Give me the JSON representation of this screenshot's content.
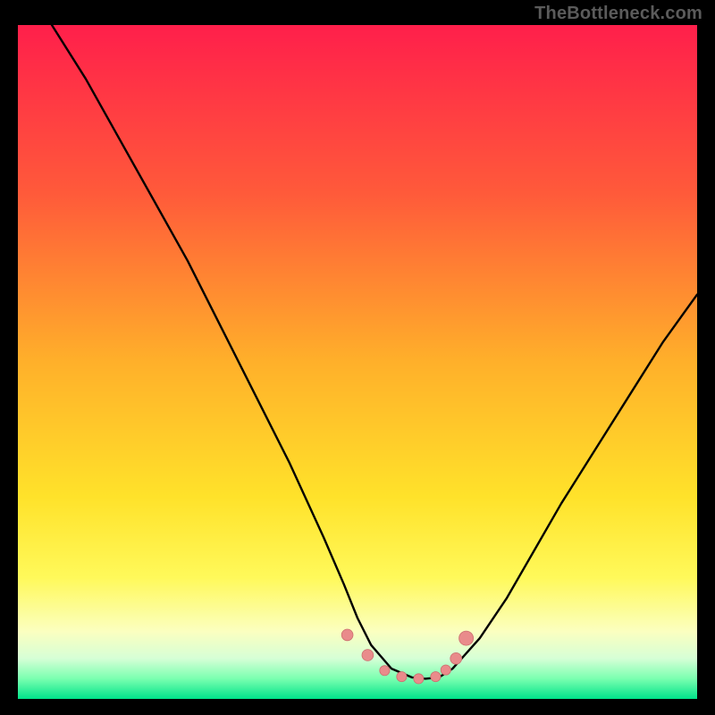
{
  "watermark": "TheBottleneck.com",
  "colors": {
    "frame": "#000000",
    "watermark": "#5b5b5b",
    "gradient_stops": [
      {
        "offset": 0.0,
        "color": "#ff1f4b"
      },
      {
        "offset": 0.25,
        "color": "#ff5a3a"
      },
      {
        "offset": 0.5,
        "color": "#ffb02a"
      },
      {
        "offset": 0.7,
        "color": "#ffe22a"
      },
      {
        "offset": 0.82,
        "color": "#fff95a"
      },
      {
        "offset": 0.9,
        "color": "#fbffc0"
      },
      {
        "offset": 0.94,
        "color": "#d6ffd6"
      },
      {
        "offset": 0.97,
        "color": "#7affb0"
      },
      {
        "offset": 1.0,
        "color": "#00e38a"
      }
    ],
    "curve_stroke": "#000000",
    "marker_fill": "#e98b8b",
    "marker_stroke": "#cc6f6f"
  },
  "chart_data": {
    "type": "line",
    "title": "",
    "xlabel": "",
    "ylabel": "",
    "xlim": [
      0,
      100
    ],
    "ylim": [
      0,
      100
    ],
    "grid": false,
    "legend": false,
    "description": "Bottleneck-style V-curve on vertical red→green gradient; minimum plateau near x≈55–63 at y≈3. Left branch descends steeply from top-left; right branch rises more gently to y≈60 at x=100. A small cluster of salmon markers sits around the trough.",
    "series": [
      {
        "name": "curve",
        "x": [
          5,
          10,
          15,
          20,
          25,
          30,
          35,
          40,
          45,
          48,
          50,
          52,
          55,
          58,
          60,
          62,
          64,
          68,
          72,
          76,
          80,
          85,
          90,
          95,
          100
        ],
        "y": [
          100,
          92,
          83,
          74,
          65,
          55,
          45,
          35,
          24,
          17,
          12,
          8,
          4.5,
          3.2,
          3.0,
          3.2,
          4.5,
          9,
          15,
          22,
          29,
          37,
          45,
          53,
          60
        ]
      }
    ],
    "markers": {
      "name": "trough-points",
      "x": [
        48.5,
        51.5,
        54,
        56.5,
        59,
        61.5,
        63,
        64.5,
        66
      ],
      "y": [
        9.5,
        6.5,
        4.2,
        3.3,
        3.0,
        3.3,
        4.3,
        6.0,
        9.0
      ],
      "r": [
        4,
        4,
        3.5,
        3.5,
        3.5,
        3.5,
        3.5,
        4,
        5
      ]
    }
  }
}
